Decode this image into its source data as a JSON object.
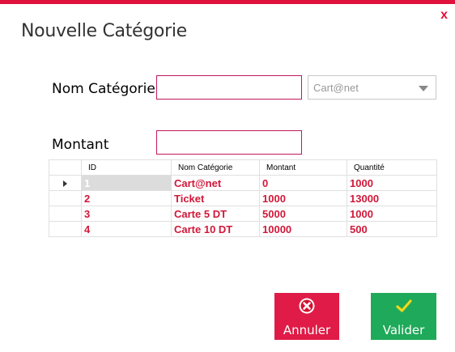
{
  "window": {
    "title": "Nouvelle Catégorie",
    "close_label": "x"
  },
  "form": {
    "nom_label": "Nom Catégorie",
    "nom_value": "",
    "montant_label": "Montant",
    "montant_value": "",
    "combo_value": "Cart@net"
  },
  "grid": {
    "columns": [
      "ID",
      "Nom Catégorie",
      "Montant",
      "Quantité"
    ],
    "rows": [
      {
        "id": "1",
        "nom": "Cart@net",
        "montant": "0",
        "quantite": "1000"
      },
      {
        "id": "2",
        "nom": "Ticket",
        "montant": "1000",
        "quantite": "13000"
      },
      {
        "id": "3",
        "nom": "Carte 5 DT",
        "montant": "5000",
        "quantite": "1000"
      },
      {
        "id": "4",
        "nom": "Carte 10 DT",
        "montant": "10000",
        "quantite": "500"
      }
    ]
  },
  "buttons": {
    "annuler_label": "Annuler",
    "annuler_icon": "cancel-icon",
    "valider_label": "Valider",
    "valider_icon": "check-icon"
  },
  "colors": {
    "accent": "#e0113a",
    "cancel": "#e01b47",
    "confirm": "#1fa95a",
    "grid_text": "#d01839"
  }
}
